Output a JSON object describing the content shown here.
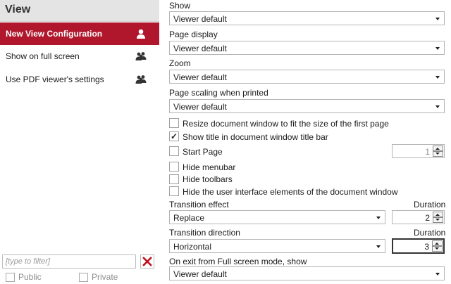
{
  "left_panel": {
    "title": "View",
    "views": [
      {
        "label": "New View Configuration",
        "icon": "single-user-icon",
        "selected": true
      },
      {
        "label": "Show on full screen",
        "icon": "group-icon",
        "selected": false
      },
      {
        "label": "Use PDF viewer's settings",
        "icon": "group-icon",
        "selected": false
      }
    ],
    "filter": {
      "placeholder": "[type to filter]",
      "value": ""
    },
    "public_label": "Public",
    "private_label": "Private",
    "colors": {
      "selected_bg": "#b0172c",
      "clear_icon": "#c0101e"
    }
  },
  "settings": {
    "show": {
      "label": "Show",
      "value": "Viewer default"
    },
    "page_display": {
      "label": "Page display",
      "value": "Viewer default"
    },
    "zoom": {
      "label": "Zoom",
      "value": "Viewer default"
    },
    "page_scaling": {
      "label": "Page scaling when printed",
      "value": "Viewer default"
    },
    "resize_window": {
      "label": "Resize document window to fit the size of the first page",
      "checked": false
    },
    "show_title": {
      "label": "Show title in document window title bar",
      "checked": true
    },
    "start_page": {
      "label": "Start Page",
      "checked": false,
      "value": "1"
    },
    "hide_menubar": {
      "label": "Hide menubar",
      "checked": false
    },
    "hide_toolbars": {
      "label": "Hide toolbars",
      "checked": false
    },
    "hide_ui": {
      "label": "Hide the user interface elements of the document window",
      "checked": false
    },
    "transition_effect": {
      "label": "Transition effect",
      "value": "Replace",
      "duration_label": "Duration",
      "duration": "2"
    },
    "transition_direction": {
      "label": "Transition direction",
      "value": "Horizontal",
      "duration_label": "Duration",
      "duration": "3"
    },
    "on_exit": {
      "label": "On exit from Full screen mode, show",
      "value": "Viewer default"
    }
  }
}
